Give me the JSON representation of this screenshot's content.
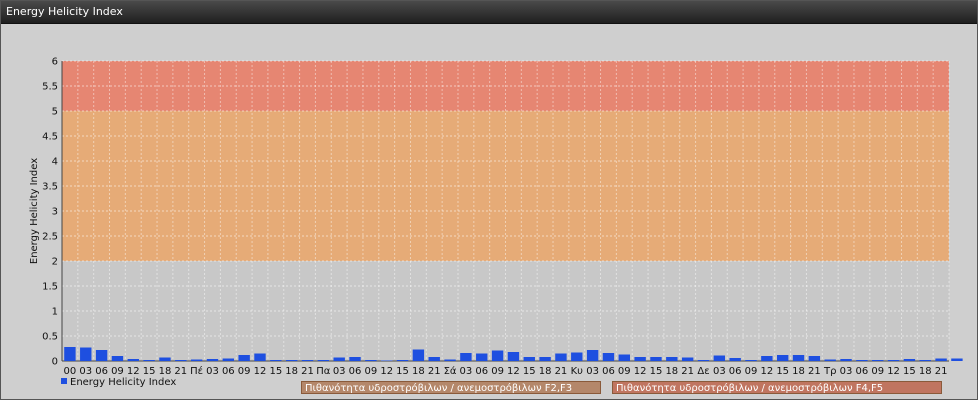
{
  "window": {
    "title": "Energy Helicity Index"
  },
  "colors": {
    "bar": "#1e4fe0",
    "band_f4f5": "#e8806a",
    "band_f2f3": "#e8a870",
    "plot_bg": "#c8c8c8"
  },
  "legend": {
    "series_label": "Energy Helicity Index",
    "band_f2f3": "Πιθανότητα υδροστρόβιλων / ανεμοστρόβιλων F2,F3",
    "band_f4f5": "Πιθανότητα υδροστρόβιλων / ανεμοστρόβιλων F4,F5"
  },
  "chart_data": {
    "type": "bar",
    "title": "Energy Helicity Index",
    "ylabel": "Energy Helicity Index",
    "xlabel": "",
    "ylim": [
      0,
      6
    ],
    "yticks": [
      "0",
      "0.5",
      "1",
      "1.5",
      "2",
      "2.5",
      "3",
      "3.5",
      "4",
      "4.5",
      "5",
      "5.5",
      "6"
    ],
    "grid": true,
    "legend_position": "bottom",
    "bands": [
      {
        "from": 2,
        "to": 5,
        "name": "Πιθανότητα υδροστρόβιλων / ανεμοστρόβιλων F2,F3"
      },
      {
        "from": 5,
        "to": 6,
        "name": "Πιθανότητα υδροστρόβιλων / ανεμοστρόβιλων F4,F5"
      }
    ],
    "categories": [
      "00",
      "03",
      "06",
      "09",
      "12",
      "15",
      "18",
      "21",
      "Πέ",
      "03",
      "06",
      "09",
      "12",
      "15",
      "18",
      "21",
      "Πα",
      "03",
      "06",
      "09",
      "12",
      "15",
      "18",
      "21",
      "Σά",
      "03",
      "06",
      "09",
      "12",
      "15",
      "18",
      "21",
      "Κυ",
      "03",
      "06",
      "09",
      "12",
      "15",
      "18",
      "21",
      "Δε",
      "03",
      "06",
      "09",
      "12",
      "15",
      "18",
      "21",
      "Τρ",
      "03",
      "06",
      "09",
      "12",
      "15",
      "18",
      "21"
    ],
    "series": [
      {
        "name": "Energy Helicity Index",
        "values": [
          0.28,
          0.27,
          0.22,
          0.1,
          0.04,
          0.02,
          0.07,
          0.02,
          0.03,
          0.04,
          0.05,
          0.12,
          0.15,
          0.02,
          0.02,
          0.02,
          0.02,
          0.07,
          0.08,
          0.02,
          0.01,
          0.02,
          0.23,
          0.08,
          0.03,
          0.16,
          0.15,
          0.21,
          0.18,
          0.08,
          0.08,
          0.15,
          0.17,
          0.22,
          0.16,
          0.13,
          0.08,
          0.08,
          0.08,
          0.07,
          0.02,
          0.11,
          0.06,
          0.02,
          0.1,
          0.12,
          0.12,
          0.1,
          0.03,
          0.04,
          0.02,
          0.02,
          0.02,
          0.04,
          0.02,
          0.05,
          0.05
        ]
      }
    ]
  }
}
